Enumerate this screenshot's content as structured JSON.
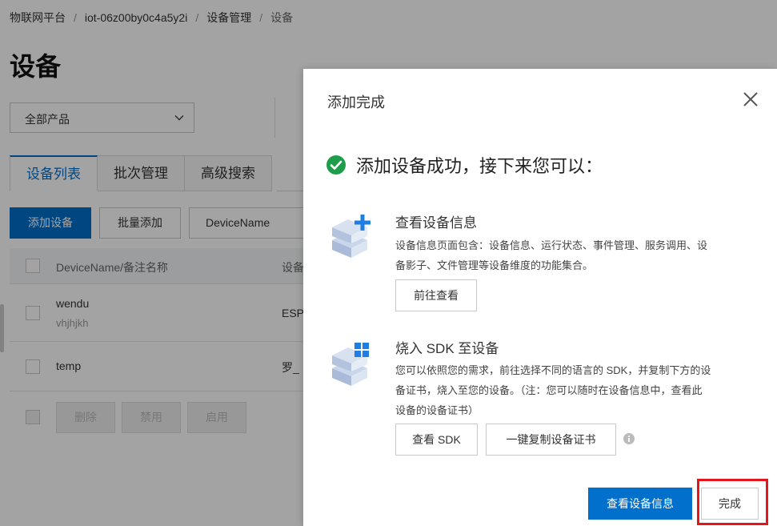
{
  "breadcrumb": {
    "items": [
      "物联网平台",
      "iot-06z00by0c4a5y2i",
      "设备管理",
      "设备"
    ],
    "separator": "/"
  },
  "page": {
    "title": "设备",
    "product_select": "全部产品",
    "tabs": [
      "设备列表",
      "批次管理",
      "高级搜索"
    ],
    "add_device": "添加设备",
    "batch_add": "批量添加",
    "search_field_value": "DeviceName",
    "table": {
      "col1_header": "DeviceName/备注名称",
      "col2_header": "设备",
      "rows": [
        {
          "name": "wendu",
          "note": "vhjhjkh",
          "col2": "ESP_"
        },
        {
          "name": "temp",
          "note": "",
          "col2": "罗_"
        }
      ]
    },
    "bulk_actions": [
      "删除",
      "禁用",
      "启用"
    ]
  },
  "drawer": {
    "title": "添加完成",
    "success_text": "添加设备成功，接下来您可以：",
    "item1": {
      "title": "查看设备信息",
      "desc_line1": "设备信息页面包含：设备信息、运行状态、事件管理、服务调用、设",
      "desc_line2": "备影子、文件管理等设备维度的功能集合。",
      "button": "前往查看"
    },
    "item2": {
      "title": "烧入 SDK 至设备",
      "desc_line1": "您可以依照您的需求，前往选择不同的语言的 SDK，并复制下方的设",
      "desc_line2": "备证书，烧入至您的设备。（注：您可以随时在设备信息中，查看此",
      "desc_line3": "设备的设备证书）",
      "button_sdk": "查看 SDK",
      "button_copy": "一键复制设备证书"
    },
    "footer": {
      "primary": "查看设备信息",
      "done": "完成"
    }
  },
  "colors": {
    "primary": "#0070cc",
    "success": "#1e9e4a",
    "highlight": "#e5151c"
  },
  "icons": [
    "chevron-down-icon",
    "close-icon",
    "check-circle-icon",
    "device-add-icon",
    "device-sdk-icon",
    "info-icon"
  ]
}
